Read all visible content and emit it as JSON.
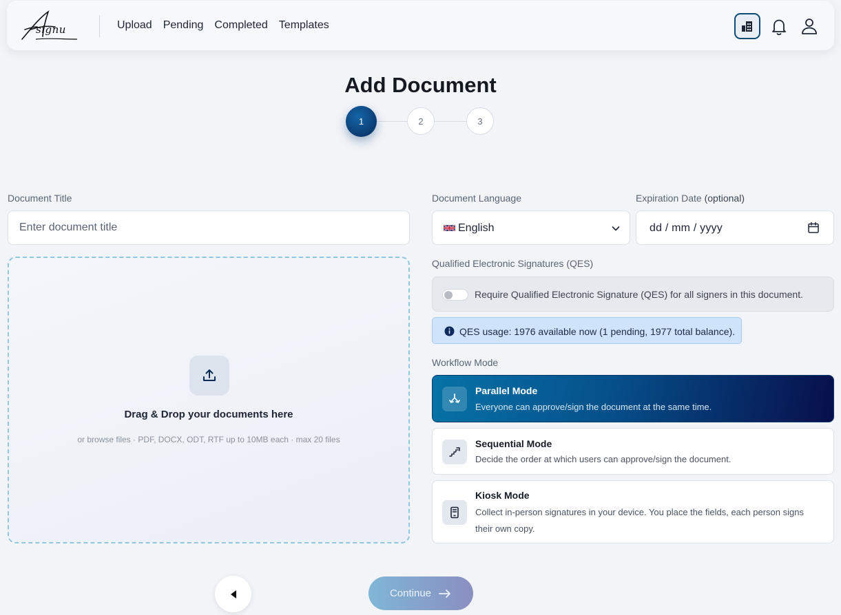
{
  "header": {
    "logo_text": "signu",
    "nav": [
      "Upload",
      "Pending",
      "Completed",
      "Templates"
    ],
    "icons": [
      "building-icon",
      "bell-icon",
      "user-icon"
    ]
  },
  "page": {
    "title": "Add Document",
    "steps": [
      "1",
      "2",
      "3"
    ],
    "active_step": 1
  },
  "form": {
    "document_title_label": "Document Title",
    "document_title_placeholder": "Enter document title",
    "dropzone_title": "Drag & Drop your documents here",
    "dropzone_subtitle": "or browse files · PDF, DOCX, ODT, RTF up to 10MB each · max 20 files",
    "language_label": "Document Language",
    "language_value": "English",
    "expiration_label": "Expiration Date",
    "expiration_optional": "(optional)",
    "expiration_placeholder": "dd / mm / yyyy",
    "qes_section_label": "Qualified Electronic Signatures (QES)",
    "qes_toggle_text": "Require Qualified Electronic Signature (QES) for all signers in this document.",
    "qes_toggle_on": false,
    "qes_info": "QES usage: 1976 available now (1 pending, 1977 total balance).",
    "workflow_label": "Workflow Mode"
  },
  "modes": [
    {
      "title": "Parallel Mode",
      "desc": "Everyone can approve/sign the document at the same time.",
      "selected": true,
      "icon": "parallel-icon"
    },
    {
      "title": "Sequential Mode",
      "desc": "Decide the order at which users can approve/sign the document.",
      "selected": false,
      "icon": "steps-icon"
    },
    {
      "title": "Kiosk Mode",
      "desc": "Collect in-person signatures in your device. You place the fields, each person signs their own copy.",
      "selected": false,
      "icon": "tablet-icon"
    }
  ],
  "footer": {
    "continue_label": "Continue"
  },
  "colors": {
    "accent": "#0b4a73",
    "selected_gradient_start": "#0673a6",
    "selected_gradient_end": "#070f4a",
    "dropzone_border": "#8fc7dc",
    "info_bg": "#cfe3fb"
  }
}
